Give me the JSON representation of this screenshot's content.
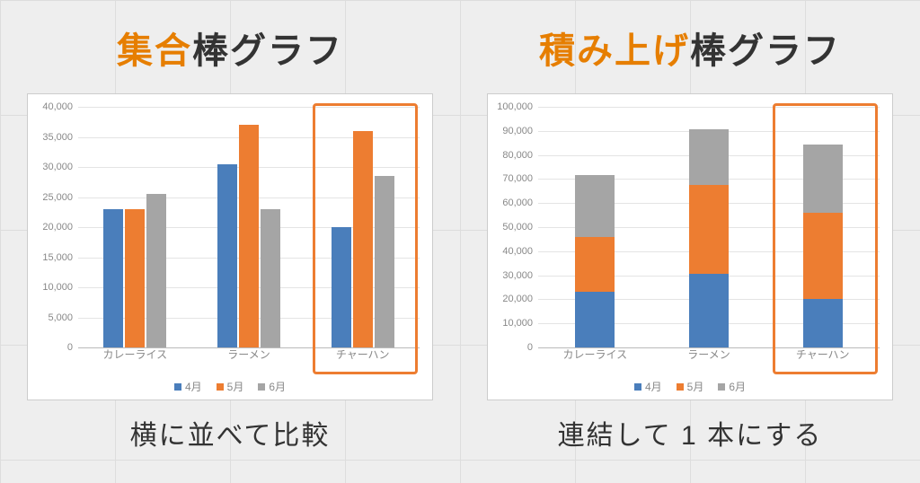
{
  "left": {
    "title_accent": "集合",
    "title_plain": "棒グラフ",
    "caption": "横に並べて比較"
  },
  "right": {
    "title_accent": "積み上げ",
    "title_plain": "棒グラフ",
    "caption": "連結して 1 本にする"
  },
  "legend": {
    "s1": "4月",
    "s2": "5月",
    "s3": "6月"
  },
  "series_colors": {
    "s1": "#4a7ebb",
    "s2": "#ed7d31",
    "s3": "#a5a5a5"
  },
  "chart_data": [
    {
      "type": "bar",
      "grouping": "clustered",
      "title": "",
      "categories": [
        "カレーライス",
        "ラーメン",
        "チャーハン"
      ],
      "series": [
        {
          "name": "4月",
          "values": [
            23000,
            30500,
            20000
          ]
        },
        {
          "name": "5月",
          "values": [
            23000,
            37000,
            36000
          ]
        },
        {
          "name": "6月",
          "values": [
            25500,
            23000,
            28500
          ]
        }
      ],
      "ylim": [
        0,
        40000
      ],
      "ystep": 5000,
      "ylabel": "",
      "xlabel": "",
      "highlight_category_index": 2
    },
    {
      "type": "bar",
      "grouping": "stacked",
      "title": "",
      "categories": [
        "カレーライス",
        "ラーメン",
        "チャーハン"
      ],
      "series": [
        {
          "name": "4月",
          "values": [
            23000,
            30500,
            20000
          ]
        },
        {
          "name": "5月",
          "values": [
            23000,
            37000,
            36000
          ]
        },
        {
          "name": "6月",
          "values": [
            25500,
            23000,
            28500
          ]
        }
      ],
      "ylim": [
        0,
        100000
      ],
      "ystep": 10000,
      "ylabel": "",
      "xlabel": "",
      "highlight_category_index": 2
    }
  ]
}
